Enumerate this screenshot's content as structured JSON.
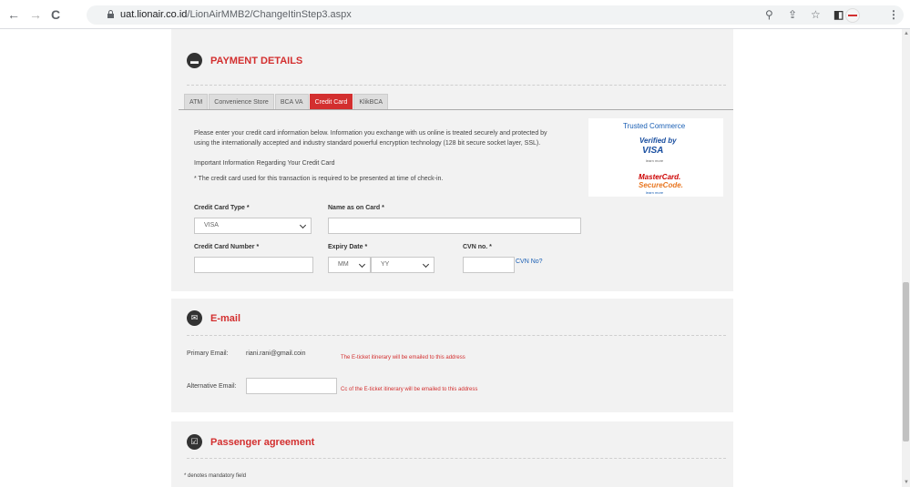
{
  "browser": {
    "url_host": "uat.lionair.co.id",
    "url_path": "/LionAirMMB2/ChangeItinStep3.aspx",
    "nav_back": "←",
    "nav_forward": "→",
    "nav_reload": "C"
  },
  "payment": {
    "title": "PAYMENT DETAILS",
    "tabs": [
      "ATM",
      "Convenience Store",
      "BCA VA",
      "Credit Card",
      "KlikBCA"
    ],
    "active_tab": "Credit Card",
    "intro": "Please enter your credit card information below. Information you exchange with us online is treated securely and protected by",
    "intro2": "using the internationally accepted and industry standard powerful encryption technology (128 bit secure socket layer, SSL).",
    "important": "Important Information Regarding Your Credit Card",
    "notice": "* The credit card used for this transaction is required to be presented at time of check-in.",
    "trust_alt": "Trusted Commerce",
    "verified_label": "Verified by",
    "visa": "VISA",
    "learn_more": "learn more",
    "mastercard": "MasterCard.",
    "securecode": "SecureCode.",
    "card_type_label": "Credit Card Type *",
    "card_type_value": "VISA",
    "name_label": "Name as on Card *",
    "name_value": "",
    "number_label": "Credit Card Number *",
    "number_value": "",
    "expiry_label": "Expiry Date *",
    "expiry_month": "MM",
    "expiry_year": "YY",
    "cvn_label": "CVN no. *",
    "cvn_value": "",
    "cvn_link": "CVN No?"
  },
  "email": {
    "title": "E-mail",
    "primary_label": "Primary Email:",
    "primary_value": "riani.rani@gmail.coin",
    "primary_note": "The E-ticket itinerary will be emailed to this address",
    "alt_label": "Alternative Email:",
    "alt_value": "",
    "alt_note": "Cc of the E-ticket itinerary will be emailed to this address"
  },
  "agreement": {
    "title": "Passenger agreement",
    "mandatory": "* denotes mandatory field"
  }
}
